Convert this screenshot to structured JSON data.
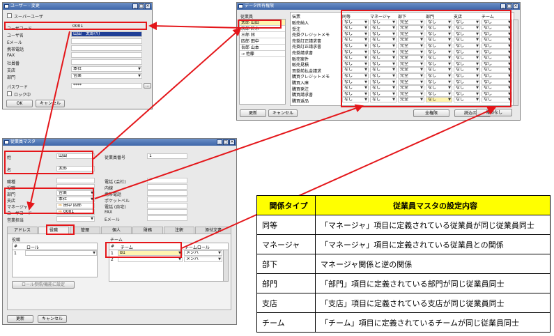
{
  "user_window": {
    "title": "ユーザー - 変更",
    "superuser_label": "スーパーユーザ",
    "fields": [
      {
        "label": "ユーザコード",
        "value": "0001"
      },
      {
        "label": "ユーザ名",
        "value": "山田　太郎(Y)"
      },
      {
        "label": "Eメール",
        "value": ""
      },
      {
        "label": "携帯電話",
        "value": ""
      },
      {
        "label": "FAX",
        "value": ""
      },
      {
        "label": "社員番",
        "value": ""
      },
      {
        "label": "支店",
        "value": "本社"
      },
      {
        "label": "部門",
        "value": "営業"
      }
    ],
    "password_label": "パスワード",
    "password_value": "****",
    "lock_label": "ロック中",
    "ok_label": "OK",
    "cancel_label": "キャンセル"
  },
  "data_window": {
    "title": "データ所有権限",
    "employee_header": "従業員",
    "employees": [
      "太郎 山田",
      "次郎 鈴木",
      "三郎 林",
      "四郎 田中",
      "吾郎 山本",
      "→ 佐藤"
    ],
    "columns": [
      "伝票",
      "同等",
      "マネージャ",
      "部下",
      "部門",
      "支店",
      "チーム"
    ],
    "rows": [
      {
        "doc": "販売納入",
        "vals": [
          "なし",
          "なし",
          "完全",
          "なし",
          "なし",
          "なし"
        ]
      },
      {
        "doc": "受注",
        "vals": [
          "なし",
          "なし",
          "完全",
          "なし",
          "なし",
          "なし"
        ]
      },
      {
        "doc": "売掛クレジットメモ",
        "vals": [
          "なし",
          "なし",
          "完全",
          "なし",
          "なし",
          "なし"
        ]
      },
      {
        "doc": "売掛訂正請求書",
        "vals": [
          "なし",
          "なし",
          "完全",
          "なし",
          "なし",
          "なし"
        ]
      },
      {
        "doc": "売掛訂正請求書",
        "vals": [
          "なし",
          "なし",
          "完全",
          "なし",
          "なし",
          "なし"
        ]
      },
      {
        "doc": "売掛請求書",
        "vals": [
          "なし",
          "なし",
          "完全",
          "なし",
          "なし",
          "なし"
        ]
      },
      {
        "doc": "販売案件",
        "vals": [
          "なし",
          "なし",
          "完全",
          "なし",
          "なし",
          "なし"
        ]
      },
      {
        "doc": "販売見積",
        "vals": [
          "なし",
          "なし",
          "完全",
          "なし",
          "なし",
          "なし"
        ]
      },
      {
        "doc": "買掛前払金請求",
        "vals": [
          "なし",
          "なし",
          "完全",
          "なし",
          "なし",
          "なし"
        ]
      },
      {
        "doc": "購買クレジットメモ",
        "vals": [
          "なし",
          "なし",
          "完全",
          "なし",
          "なし",
          "なし"
        ]
      },
      {
        "doc": "購買入庫",
        "vals": [
          "なし",
          "なし",
          "完全",
          "なし",
          "なし",
          "なし"
        ]
      },
      {
        "doc": "購買発注",
        "vals": [
          "なし",
          "なし",
          "完全",
          "なし",
          "なし",
          "なし"
        ]
      },
      {
        "doc": "購買請求書",
        "vals": [
          "なし",
          "なし",
          "完全",
          "なし",
          "なし",
          "なし"
        ]
      },
      {
        "doc": "購買返品",
        "vals": [
          "なし",
          "なし",
          "完全",
          "なし",
          "なし",
          "なし"
        ]
      }
    ],
    "update_label": "更新",
    "cancel_label": "キャンセル",
    "full_label": "全権限",
    "readonly_label": "読込のみ",
    "none_label": "権限なし"
  },
  "emp_window": {
    "title": "従業員マスタ",
    "last_name_label": "姓",
    "last_name_value": "山田",
    "first_name_label": "名",
    "first_name_value": "太郎",
    "emp_no_label": "従業員番号",
    "emp_no_value": "1",
    "left_fields": [
      {
        "label": "職種",
        "value": ""
      },
      {
        "label": "役職",
        "value": ""
      },
      {
        "label": "部門",
        "value": "営業"
      },
      {
        "label": "支店",
        "value": "本社"
      },
      {
        "label": "マネージャ",
        "value": "田中 四郎"
      },
      {
        "label": "ユーザコード",
        "value": "0001"
      },
      {
        "label": "営業担当",
        "value": ""
      }
    ],
    "right_fields": [
      {
        "label": "電話 (会社)",
        "value": ""
      },
      {
        "label": "内線",
        "value": ""
      },
      {
        "label": "携帯電話",
        "value": ""
      },
      {
        "label": "ポケットベル",
        "value": ""
      },
      {
        "label": "電話 (自宅)",
        "value": ""
      },
      {
        "label": "FAX",
        "value": ""
      },
      {
        "label": "Eメール",
        "value": ""
      }
    ],
    "tabs": [
      "アドレス",
      "役職",
      "管理",
      "個人",
      "財務",
      "注釈",
      "添付文書"
    ],
    "role_group": "役職",
    "role_col_no": "#",
    "role_col": "ロール",
    "role_rows": [
      "1"
    ],
    "team_group": "チーム",
    "team_col_no": "#",
    "team_col": "チーム",
    "team_role_col": "チームロール",
    "team_rows": [
      {
        "no": "1",
        "team": "B1",
        "role": "メンバ"
      },
      {
        "no": "2",
        "team": "",
        "role": "メンバ"
      }
    ],
    "role_def_btn": "ロール参照/機能に設定",
    "update_label": "更新",
    "cancel_label": "キャンセル"
  },
  "relation_table": {
    "header_type": "関係タイプ",
    "header_desc": "従業員マスタの設定内容",
    "rows": [
      {
        "type": "同等",
        "desc": "「マネージャ」項目に定義されている従業員が同じ従業員同士"
      },
      {
        "type": "マネージャ",
        "desc": "「マネージャ」項目に定義されている従業員との関係"
      },
      {
        "type": "部下",
        "desc": "マネージャ関係と逆の関係"
      },
      {
        "type": "部門",
        "desc": "「部門」項目に定義されている部門が同じ従業員同士"
      },
      {
        "type": "支店",
        "desc": "「支店」項目に定義されている支店が同じ従業員同士"
      },
      {
        "type": "チーム",
        "desc": "「チーム」項目に定義されているチームが同じ従業員同士"
      }
    ]
  },
  "colors": {
    "highlight": "#e4161a",
    "table_header": "#ffff00",
    "titlebar": "#3e66a8"
  }
}
